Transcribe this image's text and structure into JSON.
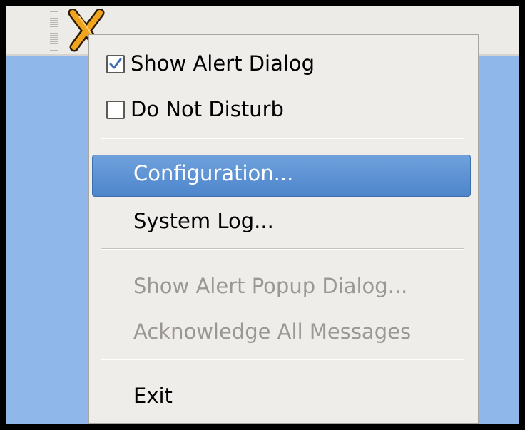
{
  "tray": {
    "icon": "x-knot-icon"
  },
  "menu": {
    "items": [
      {
        "label": "Show Alert Dialog",
        "checked": true
      },
      {
        "label": "Do Not Disturb",
        "checked": false
      },
      {
        "label": "Configuration..."
      },
      {
        "label": "System Log..."
      },
      {
        "label": "Show Alert Popup Dialog..."
      },
      {
        "label": "Acknowledge All Messages"
      },
      {
        "label": "Exit"
      }
    ]
  },
  "colors": {
    "desktop": "#90b7ea",
    "panel": "#edebe7",
    "menu_background": "#efedea",
    "highlight": "#4d85cc",
    "disabled_text": "#9b9893",
    "icon_orange": "#f2a51c"
  }
}
